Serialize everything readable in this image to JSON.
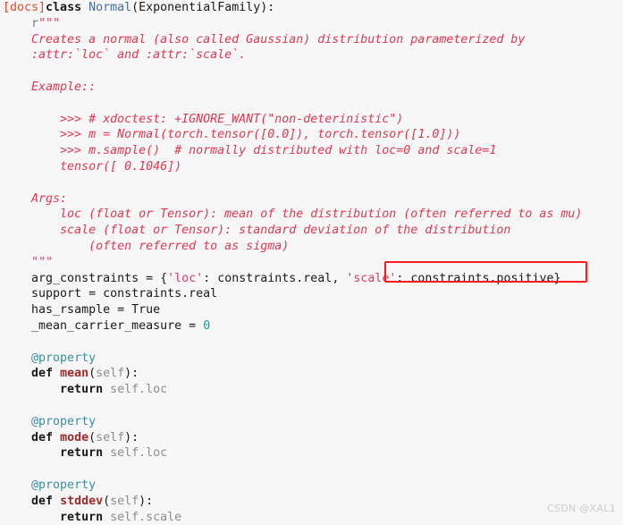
{
  "viewer": {
    "background_color": "#f7f7f7",
    "language": "python"
  },
  "colors": {
    "docs_tag": "#e8492a",
    "keyword": "#1a1a1a",
    "class_name": "#4070a0",
    "string": "#e03a5f",
    "docstring": "#dd3a54",
    "number": "#0d9b9b",
    "decorator": "#3a8f9b",
    "function_name": "#9c2b2b",
    "self_param": "#8d8d8d",
    "highlight_border": "#ff1a1a",
    "watermark": "#c9cdd4"
  },
  "code": {
    "line1": {
      "docs_tag": "[docs]",
      "kw_class": "class",
      "space": " ",
      "class_name": "Normal",
      "signature": "(ExponentialFamily):"
    },
    "line2": {
      "indent": "    ",
      "r_prefix": "r",
      "quotes": "\"\"\""
    },
    "docstring_lines": [
      "    Creates a normal (also called Gaussian) distribution parameterized by",
      "    :attr:`loc` and :attr:`scale`.",
      "",
      "    Example::",
      "",
      "        >>> # xdoctest: +IGNORE_WANT(\"non-deterinistic\")",
      "        >>> m = Normal(torch.tensor([0.0]), torch.tensor([1.0]))",
      "        >>> m.sample()  # normally distributed with loc=0 and scale=1",
      "        tensor([ 0.1046])",
      "",
      "    Args:",
      "        loc (float or Tensor): mean of the distribution (often referred to as mu)",
      "        scale (float or Tensor): standard deviation of the distribution",
      "            (often referred to as sigma)"
    ],
    "closing_quotes": {
      "indent": "    ",
      "quotes": "\"\"\""
    },
    "arg_constraints": {
      "indent": "    ",
      "name": "arg_constraints",
      "assign": " = ",
      "open_brace": "{",
      "key_loc": "'loc'",
      "sep1": ": ",
      "val_loc": "constraints.real",
      "comma": ", ",
      "key_scale": "'scale'",
      "sep2": ": ",
      "val_scale": "constraints.positive",
      "close_brace": "}"
    },
    "support": {
      "indent": "    ",
      "text": "support = constraints.real"
    },
    "has_rsample": {
      "indent": "    ",
      "text": "has_rsample = True"
    },
    "mean_carrier_measure": {
      "indent": "    ",
      "name": "_mean_carrier_measure",
      "assign": " = ",
      "value": "0"
    },
    "properties": [
      {
        "decorator": "@property",
        "kw_def": "def",
        "fn_name": "mean",
        "open_paren": "(",
        "param": "self",
        "close_paren": "):",
        "body_kw": "return",
        "body_expr": " self.loc"
      },
      {
        "decorator": "@property",
        "kw_def": "def",
        "fn_name": "mode",
        "open_paren": "(",
        "param": "self",
        "close_paren": "):",
        "body_kw": "return",
        "body_expr": " self.loc"
      },
      {
        "decorator": "@property",
        "kw_def": "def",
        "fn_name": "stddev",
        "open_paren": "(",
        "param": "self",
        "close_paren": "):",
        "body_kw": "return",
        "body_expr": " self.scale"
      }
    ]
  },
  "annotation": {
    "highlight_target": "'scale': constraints.positive"
  },
  "watermark": {
    "text": "CSDN @XAL1"
  }
}
